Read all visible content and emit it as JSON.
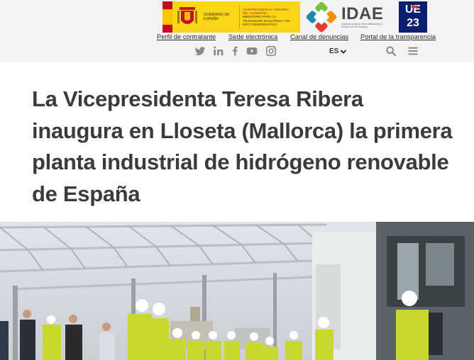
{
  "header": {
    "gov_logo": {
      "ministry_top": "Gobierno de España",
      "ministry_lines": "Vicepresidencia Tercera del Gobierno",
      "ministry_name": "Ministerio para la Transición Ecológica y el Reto Demográfico"
    },
    "idae_logo": {
      "word": "IDAE",
      "subtitle": "Instituto para la Diversificación y Ahorro de la Energía"
    },
    "eu_badge": {
      "top": "UE",
      "bottom": "23"
    },
    "links": [
      {
        "label": "Perfil de contratante"
      },
      {
        "label": "Sede electrónica"
      },
      {
        "label": "Canal de denuncias"
      },
      {
        "label": "Portal de la transparencia"
      }
    ],
    "social_icons": [
      "twitter-icon",
      "linkedin-icon",
      "facebook-icon",
      "youtube-icon",
      "instagram-icon"
    ],
    "language": "ES",
    "tool_icons": [
      "search-icon",
      "menu-icon"
    ]
  },
  "article": {
    "title": "La Vicepresidenta Teresa Ribera inaugura en Lloseta (Mallorca) la primera planta industrial de hidrógeno renovable de España"
  },
  "colors": {
    "header_bg": "#f3f3f3",
    "title_text": "#3b3b3b",
    "gov_yellow": "#f9d616",
    "eu_blue": "#0c1f6e"
  }
}
